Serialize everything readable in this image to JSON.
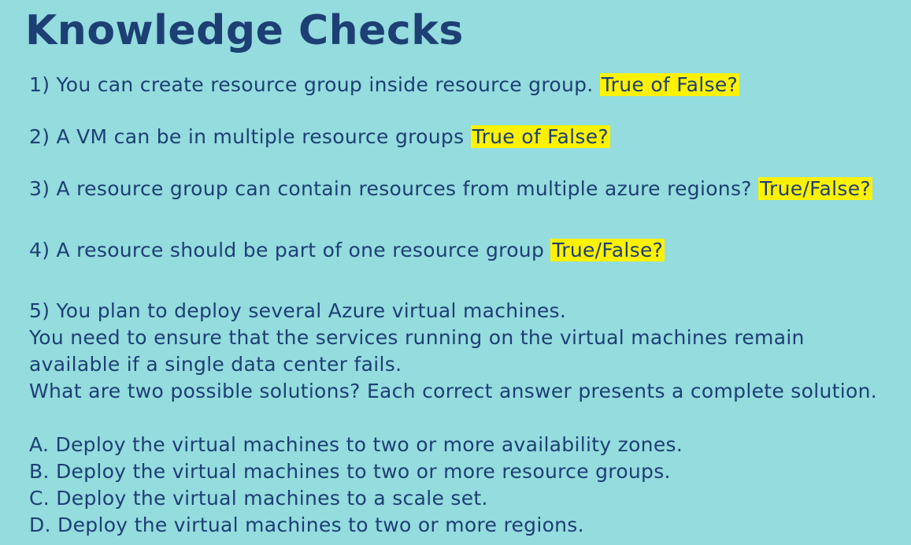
{
  "title": "Knowledge Checks",
  "questions": [
    {
      "text": "1)  You can create resource group inside resource group.",
      "answer": "True of False?"
    },
    {
      "text": "2) A VM can be in multiple resource groups",
      "answer": "True of False?"
    },
    {
      "text": "3) A resource group can contain resources from multiple azure regions?",
      "answer": "True/False?"
    },
    {
      "text": "4) A resource should be part of one resource group",
      "answer": "True/False?"
    }
  ],
  "question5": {
    "lines": [
      "5) You plan to deploy several Azure virtual machines.",
      "You need to ensure that the services running on the virtual machines remain",
      "available if a single data center fails.",
      "What are two possible solutions? Each correct answer presents a complete solution."
    ],
    "options": [
      "A. Deploy the virtual machines to two or more availability zones.",
      "B. Deploy the virtual machines to two or more resource groups.",
      "C. Deploy the virtual machines to a scale set.",
      "D. Deploy the virtual machines to two or more regions."
    ]
  },
  "colors": {
    "background": "#94dcdd",
    "text": "#1d3f74",
    "highlight": "#fff200"
  }
}
